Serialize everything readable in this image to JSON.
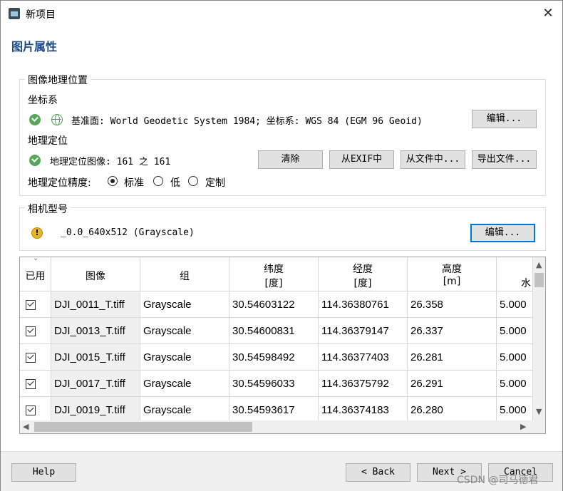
{
  "window": {
    "title": "新项目",
    "close_glyph": "✕"
  },
  "page": {
    "heading": "图片属性"
  },
  "geo": {
    "group_title": "图像地理位置",
    "coord_label": "坐标系",
    "datum_text": "基准面: World Geodetic System 1984; 坐标系: WGS 84 (EGM 96 Geoid)",
    "edit_button": "编辑...",
    "geoloc_label": "地理定位",
    "geoloc_text": "地理定位图像: 161 之 161",
    "clear_button": "清除",
    "exif_button": "从EXIF中",
    "file_button": "从文件中...",
    "export_button": "导出文件...",
    "accuracy_label": "地理定位精度:",
    "accuracy_options": [
      "标准",
      "低",
      "定制"
    ],
    "accuracy_selected": "标准"
  },
  "camera": {
    "group_title": "相机型号",
    "warning_glyph": "!",
    "model_text": "_0.0_640x512 (Grayscale)",
    "edit_button": "编辑..."
  },
  "table": {
    "headers": [
      {
        "l1": "已用",
        "l2": ""
      },
      {
        "l1": "图像",
        "l2": ""
      },
      {
        "l1": "组",
        "l2": ""
      },
      {
        "l1": "纬度",
        "l2": "[度]"
      },
      {
        "l1": "经度",
        "l2": "[度]"
      },
      {
        "l1": "高度",
        "l2": "[m]"
      },
      {
        "l1": "水",
        "l2": ""
      }
    ],
    "sort_glyph": "⌄",
    "rows": [
      {
        "enabled": true,
        "image": "DJI_0011_T.tiff",
        "group": "Grayscale",
        "lat": "30.54603122",
        "lon": "114.36380761",
        "alt": "26.358",
        "acc": "5.000"
      },
      {
        "enabled": true,
        "image": "DJI_0013_T.tiff",
        "group": "Grayscale",
        "lat": "30.54600831",
        "lon": "114.36379147",
        "alt": "26.337",
        "acc": "5.000"
      },
      {
        "enabled": true,
        "image": "DJI_0015_T.tiff",
        "group": "Grayscale",
        "lat": "30.54598492",
        "lon": "114.36377403",
        "alt": "26.281",
        "acc": "5.000"
      },
      {
        "enabled": true,
        "image": "DJI_0017_T.tiff",
        "group": "Grayscale",
        "lat": "30.54596033",
        "lon": "114.36375792",
        "alt": "26.291",
        "acc": "5.000"
      },
      {
        "enabled": true,
        "image": "DJI_0019_T.tiff",
        "group": "Grayscale",
        "lat": "30.54593617",
        "lon": "114.36374183",
        "alt": "26.280",
        "acc": "5.000"
      }
    ]
  },
  "footer": {
    "help_button": "Help",
    "back_button": "< Back",
    "next_button": "Next >",
    "cancel_button": "Cancel"
  },
  "watermark": "CSDN @司马德君",
  "colors": {
    "heading": "#1a4a8a",
    "focus_border": "#0078d7",
    "ok_green": "#57a75a",
    "warning": "#e8b523"
  },
  "icons": {
    "ok": "check-circle-icon",
    "globe": "globe-icon",
    "warning": "warning-icon",
    "close": "close-icon"
  }
}
